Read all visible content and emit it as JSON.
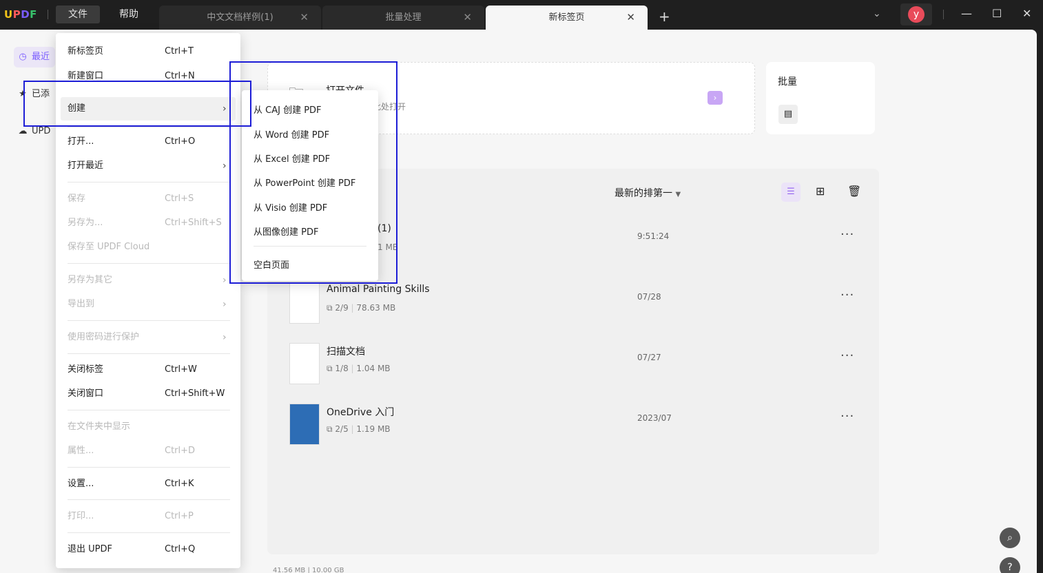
{
  "app": {
    "logo": "UPDF"
  },
  "menubar": [
    {
      "label": "文件"
    },
    {
      "label": "帮助"
    }
  ],
  "tabs": [
    {
      "label": "中文文档样例(1)"
    },
    {
      "label": "批量处理"
    },
    {
      "label": "新标签页"
    }
  ],
  "user": {
    "initial": "y"
  },
  "sidebar": [
    {
      "label": "最近"
    },
    {
      "label": "已添"
    },
    {
      "label": "UPD"
    }
  ],
  "open_card": {
    "title": "打开文件",
    "hint": "此处打开"
  },
  "batch_card": {
    "title": "批量"
  },
  "list": {
    "sort_label": "最新的排第一",
    "files": [
      {
        "name": "(1)",
        "meta": "1 MB",
        "date": "9:51:24"
      },
      {
        "name": "Animal Painting Skills",
        "pages": "2/9",
        "size": "78.63 MB",
        "date": "07/28"
      },
      {
        "name": "扫描文档",
        "pages": "1/8",
        "size": "1.04 MB",
        "date": "07/27"
      },
      {
        "name": "OneDrive 入门",
        "pages": "2/5",
        "size": "1.19 MB",
        "date": "2023/07"
      }
    ]
  },
  "storage": "41.56 MB | 10.00 GB",
  "file_menu": {
    "new_tab": {
      "label": "新标签页",
      "shortcut": "Ctrl+T"
    },
    "new_window": {
      "label": "新建窗口",
      "shortcut": "Ctrl+N"
    },
    "create": {
      "label": "创建"
    },
    "open": {
      "label": "打开...",
      "shortcut": "Ctrl+O"
    },
    "open_recent": {
      "label": "打开最近"
    },
    "save": {
      "label": "保存",
      "shortcut": "Ctrl+S"
    },
    "save_as": {
      "label": "另存为...",
      "shortcut": "Ctrl+Shift+S"
    },
    "save_cloud": {
      "label": "保存至 UPDF Cloud"
    },
    "save_other": {
      "label": "另存为其它"
    },
    "export": {
      "label": "导出到"
    },
    "protect": {
      "label": "使用密码进行保护"
    },
    "close_tab": {
      "label": "关闭标签",
      "shortcut": "Ctrl+W"
    },
    "close_window": {
      "label": "关闭窗口",
      "shortcut": "Ctrl+Shift+W"
    },
    "show_in_folder": {
      "label": "在文件夹中显示"
    },
    "properties": {
      "label": "属性...",
      "shortcut": "Ctrl+D"
    },
    "settings": {
      "label": "设置...",
      "shortcut": "Ctrl+K"
    },
    "print": {
      "label": "打印...",
      "shortcut": "Ctrl+P"
    },
    "quit": {
      "label": "退出 UPDF",
      "shortcut": "Ctrl+Q"
    }
  },
  "create_submenu": [
    {
      "label": "从 CAJ 创建 PDF"
    },
    {
      "label": "从 Word 创建 PDF"
    },
    {
      "label": "从 Excel 创建 PDF"
    },
    {
      "label": "从 PowerPoint 创建 PDF"
    },
    {
      "label": "从 Visio 创建 PDF"
    },
    {
      "label": "从图像创建 PDF"
    },
    {
      "label": "空白页面"
    }
  ]
}
